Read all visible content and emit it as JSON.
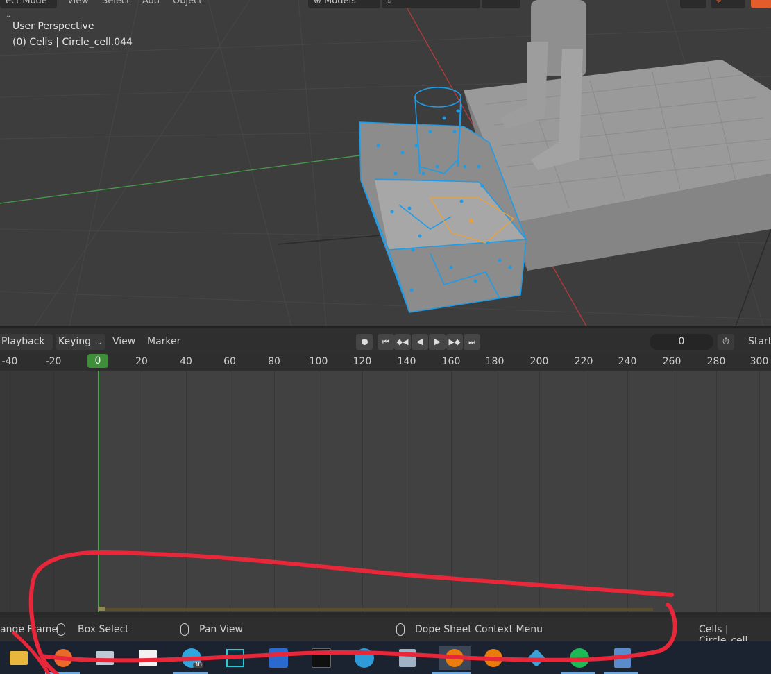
{
  "viewport": {
    "header": {
      "mode_label": "ect Mode",
      "menu": [
        "View",
        "Select",
        "Add",
        "Object"
      ],
      "collection_dropdown": "Models"
    },
    "perspective_label": "User Perspective",
    "object_info": "(0) Cells | Circle_cell.044"
  },
  "timeline": {
    "menus": {
      "playback": "Playback",
      "keying": "Keying",
      "view": "View",
      "marker": "Marker"
    },
    "current_frame": "0",
    "start_label": "Start",
    "ruler_ticks": [
      "-40",
      "-20",
      "0",
      "20",
      "40",
      "60",
      "80",
      "100",
      "120",
      "140",
      "160",
      "180",
      "200",
      "220",
      "240",
      "260",
      "280",
      "300"
    ],
    "current_frame_badge": "0"
  },
  "statusbar": {
    "left_action": "ange Frame",
    "box_select": "Box Select",
    "pan_view": "Pan View",
    "context_menu": "Dope Sheet Context Menu",
    "scene_info": "Cells | Circle_cell"
  },
  "taskbar": {
    "apps": [
      "file-explorer-icon",
      "firefox-icon",
      "resource-monitor-icon",
      "microsoft-store-icon",
      "telegram-icon",
      "epic-icon",
      "instagram-icon",
      "media-icon",
      "edge-icon",
      "blender-file-icon",
      "blender-icon",
      "blender-alt-icon",
      "paint-icon",
      "spotify-icon",
      "calculator-icon"
    ],
    "telegram_badge": "38"
  },
  "colors": {
    "selection_outline": "#1e9ce8",
    "active_face": "#f0a030",
    "x_axis": "#b83a3a",
    "y_axis": "#4c9a4c",
    "frame_badge": "#3f8f3a",
    "annotation": "#e8283a"
  }
}
